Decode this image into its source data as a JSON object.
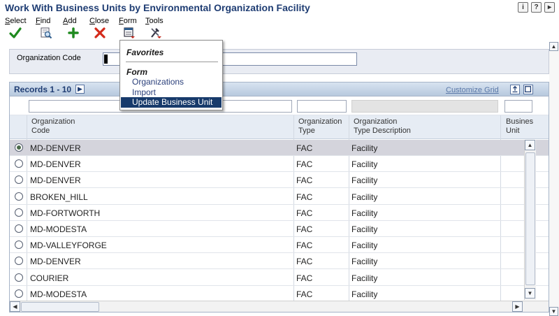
{
  "window": {
    "title": "Work With Business Units by Environmental Organization Facility",
    "icons": [
      "info-icon",
      "help-icon",
      "about-icon"
    ]
  },
  "toolbar": {
    "select": {
      "label": "Select",
      "underline": "S",
      "rest": "elect",
      "icon": "checkmark-icon"
    },
    "find": {
      "label": "Find",
      "underline": "F",
      "rest": "ind",
      "icon": "find-icon"
    },
    "add": {
      "label": "Add",
      "underline": "A",
      "rest": "dd",
      "icon": "plus-icon"
    },
    "close": {
      "label": "Close",
      "underline": "C",
      "rest": "lose",
      "icon": "close-icon"
    },
    "form": {
      "label": "Form",
      "underline": "F",
      "rest": "orm",
      "icon": "form-icon"
    },
    "tools": {
      "label": "Tools",
      "underline": "T",
      "rest": "ools",
      "icon": "tools-icon"
    }
  },
  "header": {
    "org_code_label": "Organization Code",
    "org_code_value": ""
  },
  "menu": {
    "favorites_label": "Favorites",
    "form_label": "Form",
    "items": [
      "Organizations",
      "Import",
      "Update Business Unit"
    ],
    "highlighted": "Update Business Unit"
  },
  "grid": {
    "records_label": "Records 1 - 10",
    "customize_label": "Customize Grid",
    "columns": {
      "org_code": [
        "Organization",
        "Code"
      ],
      "org_type": [
        "Organization",
        "Type"
      ],
      "org_type_desc": [
        "Organization",
        "Type Description"
      ],
      "business_unit": [
        "Busines",
        "Unit"
      ]
    },
    "rows": [
      {
        "code": "MD-DENVER",
        "type": "FAC",
        "desc": "Facility",
        "selected": true
      },
      {
        "code": "MD-DENVER",
        "type": "FAC",
        "desc": "Facility",
        "selected": false
      },
      {
        "code": "MD-DENVER",
        "type": "FAC",
        "desc": "Facility",
        "selected": false
      },
      {
        "code": "BROKEN_HILL",
        "type": "FAC",
        "desc": "Facility",
        "selected": false
      },
      {
        "code": "MD-FORTWORTH",
        "type": "FAC",
        "desc": "Facility",
        "selected": false
      },
      {
        "code": "MD-MODESTA",
        "type": "FAC",
        "desc": "Facility",
        "selected": false
      },
      {
        "code": "MD-VALLEYFORGE",
        "type": "FAC",
        "desc": "Facility",
        "selected": false
      },
      {
        "code": "MD-DENVER",
        "type": "FAC",
        "desc": "Facility",
        "selected": false
      },
      {
        "code": "COURIER",
        "type": "FAC",
        "desc": "Facility",
        "selected": false
      },
      {
        "code": "MD-MODESTA",
        "type": "FAC",
        "desc": "Facility",
        "selected": false
      }
    ]
  },
  "colors": {
    "title": "#1f3d73",
    "menu_highlight": "#173a6b",
    "selected_row": "#d4d4dc"
  }
}
